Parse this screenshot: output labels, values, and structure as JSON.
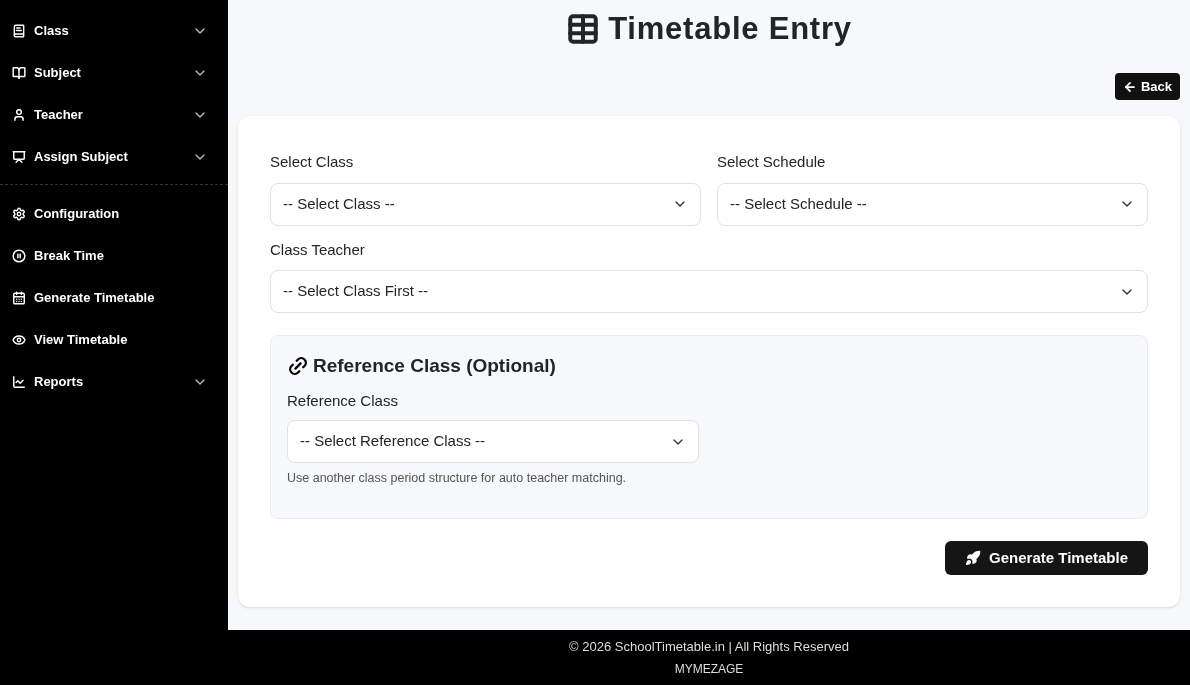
{
  "sidebar": {
    "groups": [
      {
        "items": [
          {
            "label": "Class",
            "has_submenu": true
          },
          {
            "label": "Subject",
            "has_submenu": true
          },
          {
            "label": "Teacher",
            "has_submenu": true
          },
          {
            "label": "Assign Subject",
            "has_submenu": true
          }
        ]
      },
      {
        "items": [
          {
            "label": "Configuration",
            "has_submenu": false
          },
          {
            "label": "Break Time",
            "has_submenu": false
          },
          {
            "label": "Generate Timetable",
            "has_submenu": false
          },
          {
            "label": "View Timetable",
            "has_submenu": false
          },
          {
            "label": "Reports",
            "has_submenu": true
          }
        ]
      }
    ]
  },
  "page": {
    "title": "Timetable Entry",
    "back_button": "Back"
  },
  "form": {
    "fields": [
      {
        "label": "Select Class",
        "value": "-- Select Class --"
      },
      {
        "label": "Select Schedule",
        "value": "-- Select Schedule --"
      },
      {
        "label": "Class Teacher",
        "value": "-- Select Class First --"
      }
    ],
    "reference": {
      "heading": "Reference Class (Optional)",
      "label": "Reference Class",
      "value": "-- Select Reference Class --",
      "help": "Use another class period structure for auto teacher matching."
    },
    "submit": "Generate Timetable"
  },
  "footer": {
    "copyright": "© 2026 SchoolTimetable.in | All Rights Reserved",
    "brand": "MYMEZAGE"
  }
}
